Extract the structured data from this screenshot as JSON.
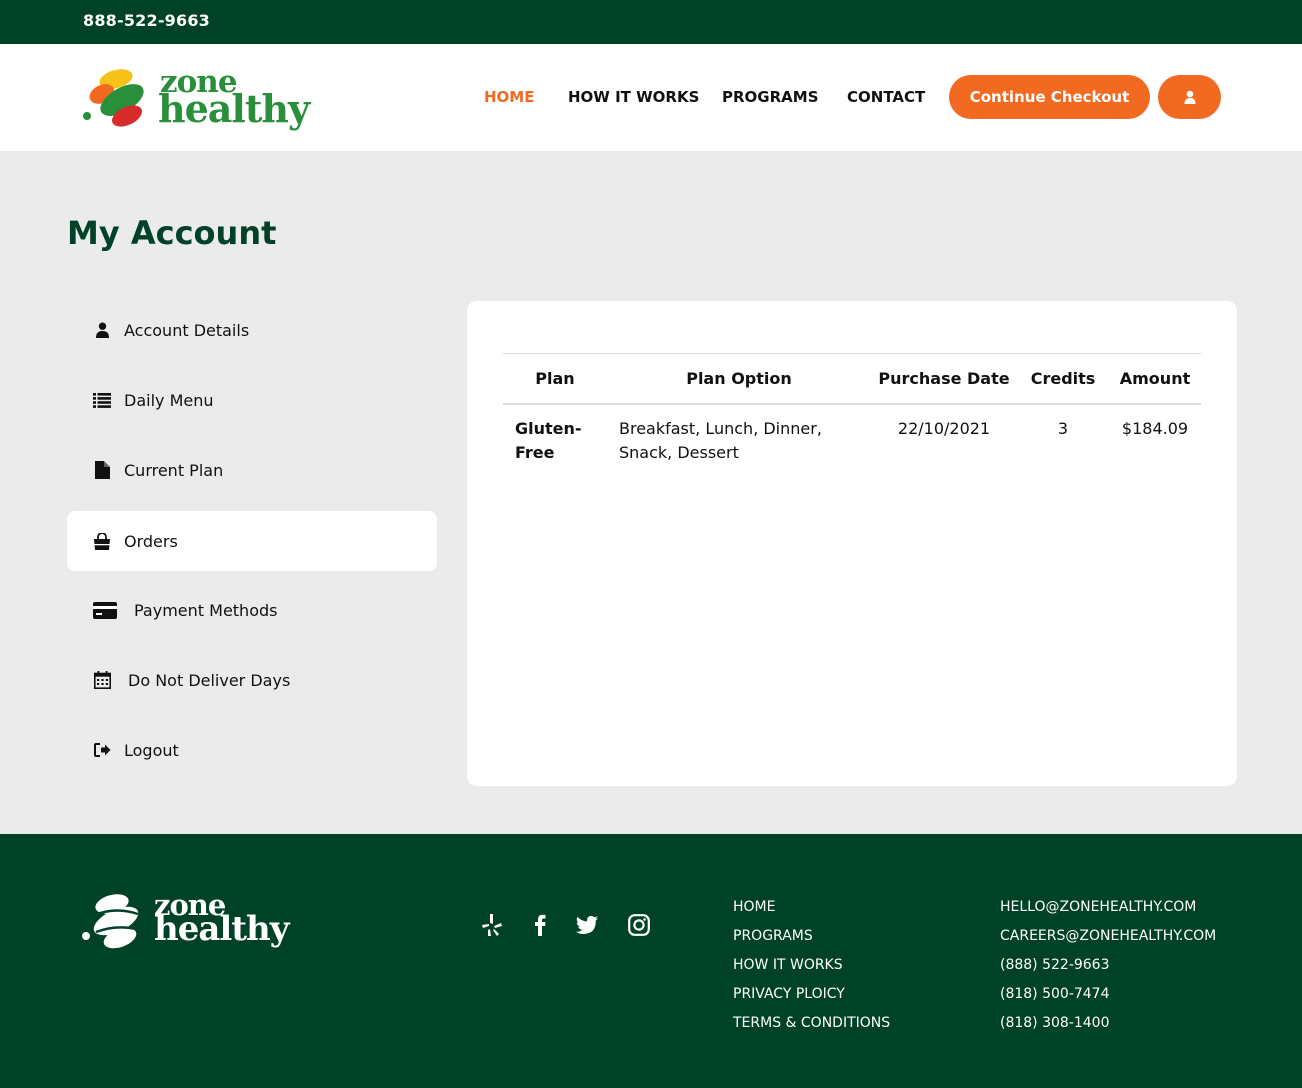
{
  "topbar": {
    "phone": "888-522-9663"
  },
  "brand": {
    "word1": "zone",
    "word2": "healthy"
  },
  "nav": {
    "items": [
      {
        "label": "HOME",
        "active": true
      },
      {
        "label": "HOW IT WORKS",
        "active": false
      },
      {
        "label": "PROGRAMS",
        "active": false
      },
      {
        "label": "CONTACT",
        "active": false
      }
    ],
    "checkout_label": "Continue Checkout",
    "user_icon": "user-icon"
  },
  "page": {
    "title": "My Account"
  },
  "sidebar": {
    "items": [
      {
        "label": "Account Details",
        "icon": "user-icon",
        "active": false
      },
      {
        "label": "Daily Menu",
        "icon": "list-icon",
        "active": false
      },
      {
        "label": "Current Plan",
        "icon": "file-icon",
        "active": false
      },
      {
        "label": "Orders",
        "icon": "shopping-bag-icon",
        "active": true
      },
      {
        "label": "Payment Methods",
        "icon": "credit-card-icon",
        "active": false
      },
      {
        "label": "Do Not Deliver Days",
        "icon": "calendar-icon",
        "active": false
      },
      {
        "label": "Logout",
        "icon": "logout-icon",
        "active": false
      }
    ]
  },
  "orders": {
    "columns": [
      "Plan",
      "Plan Option",
      "Purchase Date",
      "Credits",
      "Amount"
    ],
    "rows": [
      {
        "plan": "Gluten-Free",
        "option": "Breakfast, Lunch, Dinner, Snack, Dessert",
        "date": "22/10/2021",
        "credits": "3",
        "amount": "$184.09"
      }
    ]
  },
  "footer": {
    "social": [
      "yelp-icon",
      "facebook-icon",
      "twitter-icon",
      "instagram-icon"
    ],
    "links": [
      "HOME",
      "PROGRAMS",
      "HOW IT WORKS",
      "PRIVACY PLOICY",
      "TERMS & CONDITIONS"
    ],
    "contacts": [
      "HELLO@ZONEHEALTHY.COM",
      "CAREERS@ZONEHEALTHY.COM",
      "(888) 522-9663",
      "(818) 500-7474",
      "(818) 308-1400"
    ]
  },
  "colors": {
    "brand_green": "#004227",
    "accent_orange": "#f26a21",
    "logo_green": "#2a8f3b",
    "page_bg": "#ebebeb"
  }
}
